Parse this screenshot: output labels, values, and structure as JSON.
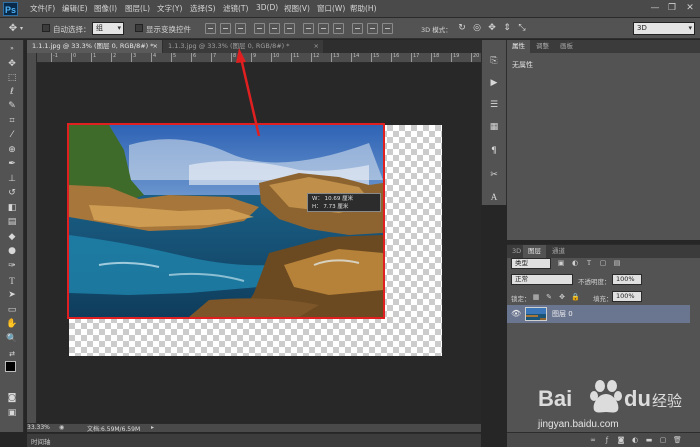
{
  "app": {
    "logo": "Ps"
  },
  "menu": [
    "文件(F)",
    "编辑(E)",
    "图像(I)",
    "图层(L)",
    "文字(Y)",
    "选择(S)",
    "滤镜(T)",
    "3D(D)",
    "视图(V)",
    "窗口(W)",
    "帮助(H)"
  ],
  "window_controls": {
    "minimize": "—",
    "restore": "❐",
    "close": "✕"
  },
  "options": {
    "auto_select_label": "自动选择：",
    "auto_select_value": "组",
    "show_transform_label": "显示变换控件",
    "mode_3d_label": "3D 模式：",
    "workspace_value": "3D"
  },
  "tabs": [
    {
      "label": "1.1.1.jpg @ 33.3% (图层 0, RGB/8#) *",
      "close": "×"
    },
    {
      "label": "1.1.3.jpg @ 33.3% (图层 0, RGB/8#) *",
      "close": "×"
    }
  ],
  "ruler_ticks": [
    "-1",
    "0",
    "1",
    "2",
    "3",
    "4",
    "5",
    "6",
    "7",
    "8",
    "9",
    "10",
    "11",
    "12",
    "13",
    "14",
    "15",
    "16",
    "17",
    "18",
    "19",
    "20"
  ],
  "measure": {
    "width": "W： 10.69 厘米",
    "height": "H： 7.73 厘米"
  },
  "status": {
    "zoom": "33.33%",
    "doc_size": "文档:6.59M/6.59M"
  },
  "timeline_label": "时间轴",
  "properties": {
    "tabs": [
      "属性",
      "调整",
      "画板"
    ],
    "no_properties": "无属性"
  },
  "layers": {
    "tabs": [
      "3D",
      "图层",
      "通道"
    ],
    "filter_kind": "类型",
    "blend_mode": "正常",
    "opacity_label": "不透明度：",
    "opacity_value": "100%",
    "lock_label": "锁定：",
    "fill_label": "填充：",
    "fill_value": "100%",
    "layer_name": "图层 0"
  },
  "watermark": {
    "text": "jingyan.baidu.com"
  }
}
